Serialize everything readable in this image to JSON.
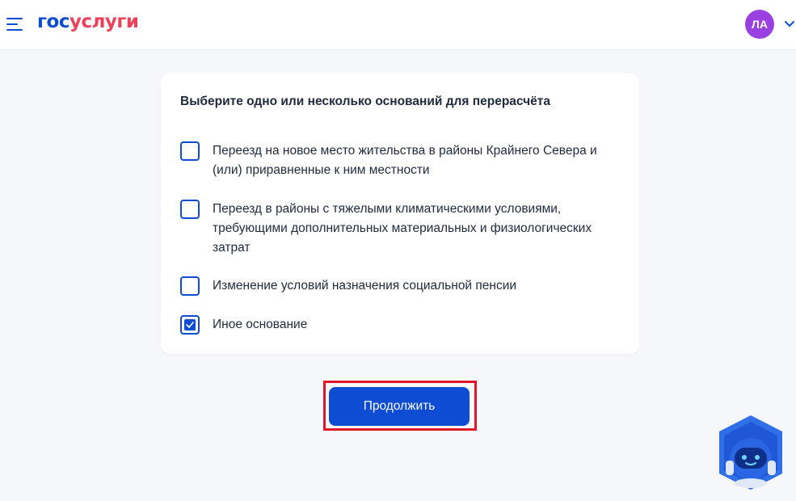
{
  "header": {
    "logo_part1": "гос",
    "logo_part2": "услуги",
    "avatar_initials": "ЛА",
    "menu_icon": "hamburger-menu-icon",
    "chevron_icon": "chevron-down-icon"
  },
  "form": {
    "title": "Выберите одно или несколько оснований для перерасчёта",
    "options": [
      {
        "label_lines": [
          "Переезд на новое место жительства в районы Крайнего Севера и",
          "(или) приравненные к ним местности"
        ],
        "checked": false
      },
      {
        "label_lines": [
          "Переезд в районы с тяжелыми климатическими условиями,",
          "требующими дополнительных материальных и физиологических",
          "затрат"
        ],
        "checked": false
      },
      {
        "label_lines": [
          "Изменение условий назначения социальной пенсии"
        ],
        "checked": false
      },
      {
        "label_lines": [
          "Иное основание"
        ],
        "checked": true
      }
    ]
  },
  "actions": {
    "continue_label": "Продолжить"
  },
  "assistant": {
    "icon": "robot-assistant-icon"
  },
  "colors": {
    "brand_blue": "#0d4cd3",
    "brand_red": "#ee3f58",
    "avatar_purple": "#9b40e0",
    "highlight_red": "#e0162b",
    "background": "#f5f7fb"
  }
}
